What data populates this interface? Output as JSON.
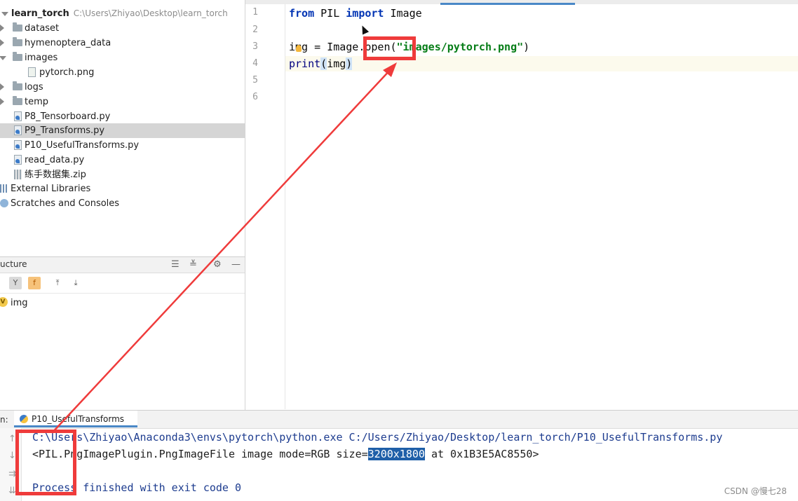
{
  "project": {
    "root_name": "learn_torch",
    "root_path": "C:\\Users\\Zhiyao\\Desktop\\learn_torch",
    "items": [
      {
        "label": "dataset",
        "kind": "folder",
        "expanded": false
      },
      {
        "label": "hymenoptera_data",
        "kind": "folder",
        "expanded": false
      },
      {
        "label": "images",
        "kind": "folder",
        "expanded": true
      },
      {
        "label": "pytorch.png",
        "kind": "png"
      },
      {
        "label": "logs",
        "kind": "folder",
        "expanded": false
      },
      {
        "label": "temp",
        "kind": "folder",
        "expanded": false
      },
      {
        "label": "P8_Tensorboard.py",
        "kind": "py"
      },
      {
        "label": "P9_Transforms.py",
        "kind": "py",
        "selected": true
      },
      {
        "label": "P10_UsefulTransforms.py",
        "kind": "py"
      },
      {
        "label": "read_data.py",
        "kind": "py"
      },
      {
        "label": "练手数据集.zip",
        "kind": "zip"
      }
    ],
    "external_libraries": "External Libraries",
    "scratches": "Scratches and Consoles"
  },
  "structure": {
    "title": "ucture",
    "entries": [
      {
        "label": "img",
        "icon": "V"
      }
    ],
    "filter_label": "f"
  },
  "editor": {
    "line_numbers": [
      "1",
      "2",
      "3",
      "4",
      "5",
      "6"
    ],
    "code": {
      "l1_kw1": "from",
      "l1_mod": " PIL ",
      "l1_kw2": "import",
      "l1_name": " Image",
      "l3_a": "img = Image",
      "l3_b": ".open(",
      "l3_str": "\"images/pytorch.png\"",
      "l3_c": ")",
      "l4_fn": "print",
      "l4_open": "(",
      "l4_arg": "img",
      "l4_close": ")"
    }
  },
  "run": {
    "prefix": "n:",
    "tab_label": "P10_UsefulTransforms",
    "lines": {
      "cmd": "C:\\Users\\Zhiyao\\Anaconda3\\envs\\pytorch\\python.exe C:/Users/Zhiyao/Desktop/learn_torch/P10_UsefulTransforms.py",
      "out_a": "<PIL.PngImagePlugin.PngImageFile image mode=RGB size=",
      "out_sel": "3200x1800",
      "out_b": " at 0x1B3E5AC8550>",
      "exit": "Process finished with exit code 0"
    }
  },
  "watermark": "CSDN @慢七28",
  "colors": {
    "annotation_red": "#ef3b3b",
    "selection_blue": "#1f5fa8",
    "accent_blue": "#4a88c7"
  }
}
